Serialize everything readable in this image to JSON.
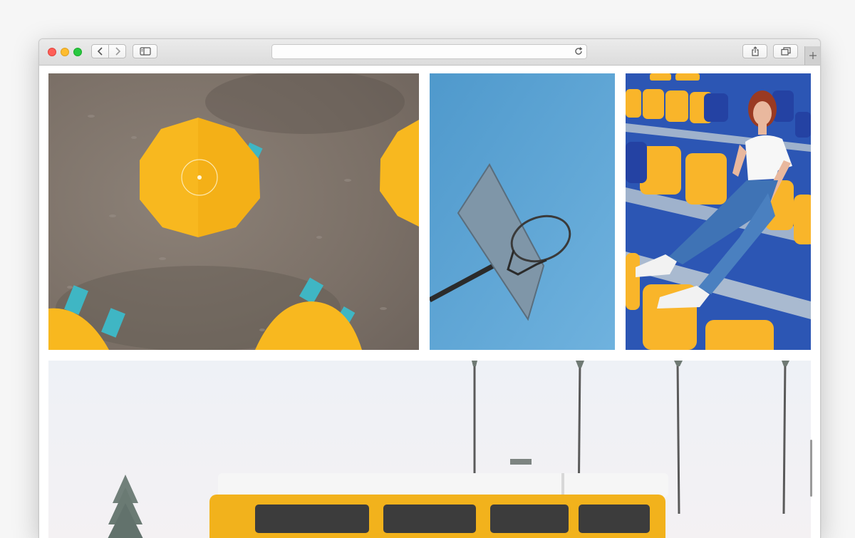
{
  "browser": {
    "address": {
      "value": "",
      "placeholder": ""
    },
    "icons": {
      "back": "chevron-left-icon",
      "forward": "chevron-right-icon",
      "sidebar": "sidebar-icon",
      "reload": "reload-icon",
      "share": "share-icon",
      "tabs": "tabs-overview-icon",
      "new_tab": "plus-icon"
    }
  },
  "gallery": {
    "photos": [
      {
        "subject": "beach-umbrellas-aerial"
      },
      {
        "subject": "basketball-hoop-sky"
      },
      {
        "subject": "woman-stadium-seats"
      },
      {
        "subject": "yellow-van-palm-trees"
      }
    ]
  },
  "colors": {
    "close": "#fe5f57",
    "minimize": "#febc2e",
    "maximize": "#28c840",
    "umbrella_yellow": "#f8b81f",
    "sky_blue": "#5aa3d3",
    "seat_yellow": "#f9b52a",
    "seat_blue": "#2f58b9",
    "van_yellow": "#f2b21c"
  }
}
